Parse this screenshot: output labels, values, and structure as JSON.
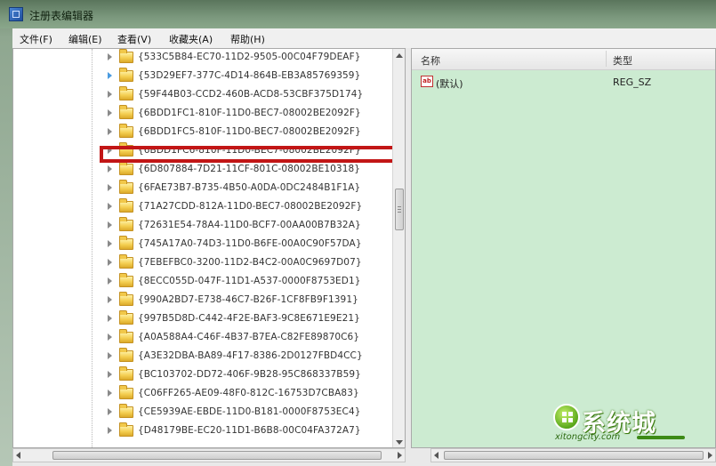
{
  "window": {
    "title": "注册表编辑器"
  },
  "menu": [
    {
      "label": "文件(F)"
    },
    {
      "label": "编辑(E)"
    },
    {
      "label": "查看(V)"
    },
    {
      "label": "收藏夹(A)"
    },
    {
      "label": "帮助(H)"
    }
  ],
  "tree": {
    "items": [
      {
        "label": "{533C5B84-EC70-11D2-9505-00C04F79DEAF}",
        "expander": "gray"
      },
      {
        "label": "{53D29EF7-377C-4D14-864B-EB3A85769359}",
        "expander": "blue"
      },
      {
        "label": "{59F44B03-CCD2-460B-ACD8-53CBF375D174}",
        "expander": "gray"
      },
      {
        "label": "{6BDD1FC1-810F-11D0-BEC7-08002BE2092F}",
        "expander": "gray"
      },
      {
        "label": "{6BDD1FC5-810F-11D0-BEC7-08002BE2092F}",
        "expander": "gray"
      },
      {
        "label": "{6BDD1FC6-810F-11D0-BEC7-08002BE2092F}",
        "expander": "gray",
        "highlighted": true
      },
      {
        "label": "{6D807884-7D21-11CF-801C-08002BE10318}",
        "expander": "gray"
      },
      {
        "label": "{6FAE73B7-B735-4B50-A0DA-0DC2484B1F1A}",
        "expander": "gray"
      },
      {
        "label": "{71A27CDD-812A-11D0-BEC7-08002BE2092F}",
        "expander": "gray"
      },
      {
        "label": "{72631E54-78A4-11D0-BCF7-00AA00B7B32A}",
        "expander": "gray"
      },
      {
        "label": "{745A17A0-74D3-11D0-B6FE-00A0C90F57DA}",
        "expander": "gray"
      },
      {
        "label": "{7EBEFBC0-3200-11D2-B4C2-00A0C9697D07}",
        "expander": "gray"
      },
      {
        "label": "{8ECC055D-047F-11D1-A537-0000F8753ED1}",
        "expander": "gray"
      },
      {
        "label": "{990A2BD7-E738-46C7-B26F-1CF8FB9F1391}",
        "expander": "gray"
      },
      {
        "label": "{997B5D8D-C442-4F2E-BAF3-9C8E671E9E21}",
        "expander": "gray"
      },
      {
        "label": "{A0A588A4-C46F-4B37-B7EA-C82FE89870C6}",
        "expander": "gray"
      },
      {
        "label": "{A3E32DBA-BA89-4F17-8386-2D0127FBD4CC}",
        "expander": "gray"
      },
      {
        "label": "{BC103702-DD72-406F-9B28-95C868337B59}",
        "expander": "gray"
      },
      {
        "label": "{C06FF265-AE09-48F0-812C-16753D7CBA83}",
        "expander": "gray"
      },
      {
        "label": "{CE5939AE-EBDE-11D0-B181-0000F8753EC4}",
        "expander": "gray"
      },
      {
        "label": "{D48179BE-EC20-11D1-B6B8-00C04FA372A7}",
        "expander": "gray"
      }
    ]
  },
  "list": {
    "columns": {
      "name": "名称",
      "type": "类型"
    },
    "rows": [
      {
        "icon": "ab",
        "name": "(默认)",
        "type": "REG_SZ"
      }
    ]
  },
  "watermark": {
    "text": "系统城",
    "site": "xitongcity.com"
  },
  "colors": {
    "highlight": "#c21616",
    "list_background": "#ccebd1",
    "folder": "#f4cf52"
  }
}
